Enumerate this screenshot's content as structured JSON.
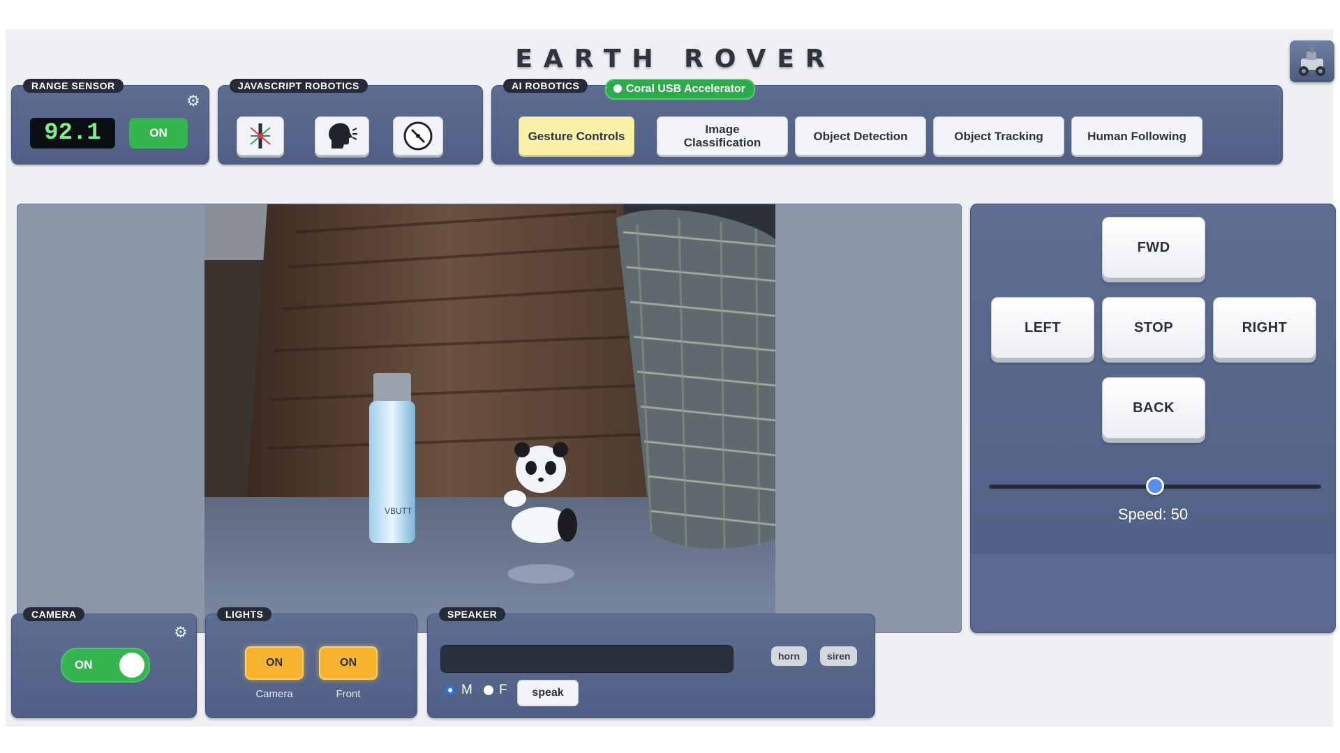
{
  "app": {
    "title": "EARTH ROVER"
  },
  "range_sensor": {
    "label": "RANGE SENSOR",
    "value": "92.1",
    "toggle_label": "ON"
  },
  "js_robotics": {
    "label": "JAVASCRIPT ROBOTICS",
    "icons": [
      "joystick-icon",
      "voice-speaking-icon",
      "compass-icon"
    ]
  },
  "ai_robotics": {
    "label": "AI ROBOTICS",
    "accelerator_badge": "Coral USB Accelerator",
    "modes": [
      {
        "label": "Gesture Controls",
        "active": true
      },
      {
        "label": "Image Classification",
        "active": false
      },
      {
        "label": "Object Detection",
        "active": false
      },
      {
        "label": "Object Tracking",
        "active": false
      },
      {
        "label": "Human Following",
        "active": false
      }
    ]
  },
  "drive": {
    "forward": "FWD",
    "left": "LEFT",
    "stop": "STOP",
    "right": "RIGHT",
    "back": "BACK",
    "speed": 50,
    "speed_label": "Speed: 50"
  },
  "camera": {
    "label": "CAMERA",
    "toggle_label": "ON"
  },
  "lights": {
    "label": "LIGHTS",
    "buttons": [
      {
        "label": "ON",
        "caption": "Camera"
      },
      {
        "label": "ON",
        "caption": "Front"
      }
    ]
  },
  "speaker": {
    "label": "SPEAKER",
    "text_value": "",
    "horn": "horn",
    "siren": "siren",
    "voice_options": [
      "M",
      "F"
    ],
    "selected_voice": "M",
    "speak": "speak"
  },
  "video": {
    "bottle_text": "VBUTT"
  },
  "colors": {
    "panel": "#56668b",
    "accent_green": "#35b44f",
    "accent_yellow": "#fbf0a8",
    "light_orange": "#f6b42e",
    "slider_blue": "#5b8dee"
  }
}
